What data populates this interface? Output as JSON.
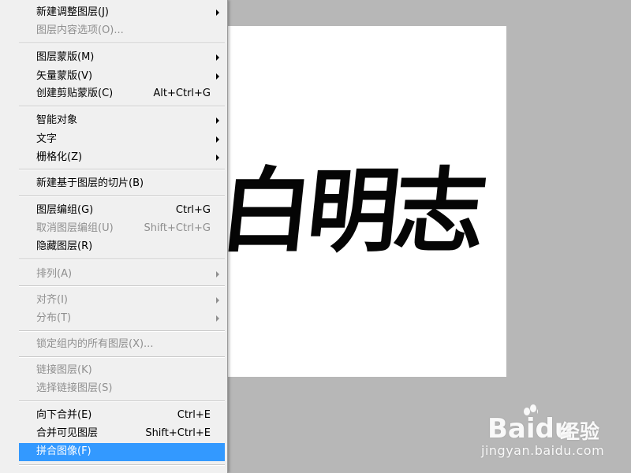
{
  "document": {
    "calligraphy_text": "白明志"
  },
  "menu": {
    "items": [
      {
        "label": "新建调整图层(J)",
        "shortcut": "",
        "submenu": true,
        "disabled": false
      },
      {
        "label": "图层内容选项(O)...",
        "shortcut": "",
        "submenu": false,
        "disabled": true
      },
      {
        "label": "图层蒙版(M)",
        "shortcut": "",
        "submenu": true,
        "disabled": false
      },
      {
        "label": "矢量蒙版(V)",
        "shortcut": "",
        "submenu": true,
        "disabled": false
      },
      {
        "label": "创建剪贴蒙版(C)",
        "shortcut": "Alt+Ctrl+G",
        "submenu": false,
        "disabled": false
      },
      {
        "label": "智能对象",
        "shortcut": "",
        "submenu": true,
        "disabled": false
      },
      {
        "label": "文字",
        "shortcut": "",
        "submenu": true,
        "disabled": false
      },
      {
        "label": "栅格化(Z)",
        "shortcut": "",
        "submenu": true,
        "disabled": false
      },
      {
        "label": "新建基于图层的切片(B)",
        "shortcut": "",
        "submenu": false,
        "disabled": false
      },
      {
        "label": "图层编组(G)",
        "shortcut": "Ctrl+G",
        "submenu": false,
        "disabled": false
      },
      {
        "label": "取消图层编组(U)",
        "shortcut": "Shift+Ctrl+G",
        "submenu": false,
        "disabled": true
      },
      {
        "label": "隐藏图层(R)",
        "shortcut": "",
        "submenu": false,
        "disabled": false
      },
      {
        "label": "排列(A)",
        "shortcut": "",
        "submenu": true,
        "disabled": true
      },
      {
        "label": "对齐(I)",
        "shortcut": "",
        "submenu": true,
        "disabled": true
      },
      {
        "label": "分布(T)",
        "shortcut": "",
        "submenu": true,
        "disabled": true
      },
      {
        "label": "锁定组内的所有图层(X)...",
        "shortcut": "",
        "submenu": false,
        "disabled": true
      },
      {
        "label": "链接图层(K)",
        "shortcut": "",
        "submenu": false,
        "disabled": true
      },
      {
        "label": "选择链接图层(S)",
        "shortcut": "",
        "submenu": false,
        "disabled": true
      },
      {
        "label": "向下合并(E)",
        "shortcut": "Ctrl+E",
        "submenu": false,
        "disabled": false
      },
      {
        "label": "合并可见图层",
        "shortcut": "Shift+Ctrl+E",
        "submenu": false,
        "disabled": false
      },
      {
        "label": "拼合图像(F)",
        "shortcut": "",
        "submenu": false,
        "disabled": false,
        "highlighted": true
      }
    ]
  },
  "watermark": {
    "brand": "Bai",
    "brand_suffix": "du",
    "product": "经验",
    "url": "jingyan.baidu.com"
  },
  "colors": {
    "menu_bg": "#f0f0f0",
    "highlight": "#3399ff",
    "disabled_text": "#8f8f8f",
    "canvas_bg": "#b7b7b7",
    "document_bg": "#ffffff"
  }
}
